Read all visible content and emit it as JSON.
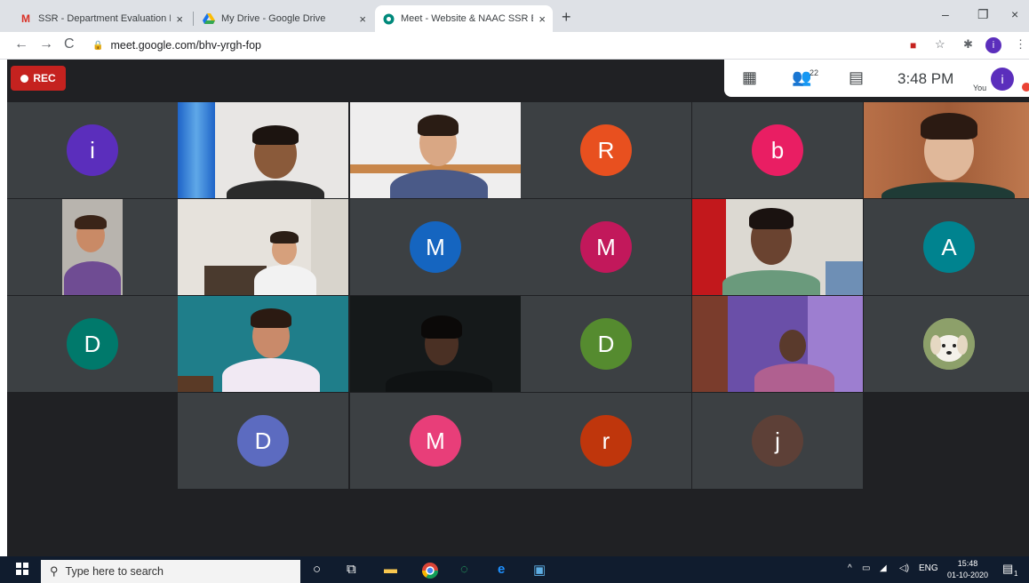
{
  "browser": {
    "tabs": [
      {
        "label": "SSR - Department Evaluation Rep",
        "close": "×",
        "icon": "gmail-icon"
      },
      {
        "label": "My Drive - Google Drive",
        "close": "×",
        "icon": "drive-icon"
      },
      {
        "label": "Meet - Website & NAAC SSR Eva",
        "close": "×",
        "icon": "meet-icon"
      }
    ],
    "new_tab": "+",
    "url": "meet.google.com/bhv-yrgh-fop",
    "profile_initial": "i",
    "window_controls": {
      "minimize": "–",
      "restore": "❐",
      "close": "×"
    }
  },
  "meet": {
    "rec_label": "REC",
    "participants_count": "22",
    "time": "3:48 PM",
    "you_label": "You",
    "you_initial": "i",
    "tiles": [
      {
        "type": "avatar",
        "initial": "i",
        "color": "#5b2ebc"
      },
      {
        "type": "video",
        "variant": "blue-curtain"
      },
      {
        "type": "video",
        "variant": "white-wall"
      },
      {
        "type": "empty"
      },
      {
        "type": "avatar",
        "initial": "R",
        "color": "#e8501f"
      },
      {
        "type": "avatar",
        "initial": "b",
        "color": "#e91e63"
      },
      {
        "type": "video",
        "variant": "wood-headset"
      },
      {
        "type": "video",
        "variant": "small-portrait"
      },
      {
        "type": "video",
        "variant": "room-white"
      },
      {
        "type": "avatar",
        "initial": "M",
        "color": "#1565c0"
      },
      {
        "type": "avatar",
        "initial": "M",
        "color": "#c2185b"
      },
      {
        "type": "video",
        "variant": "red-curtain"
      },
      {
        "type": "avatar",
        "initial": "A",
        "color": "#00838f"
      },
      {
        "type": "avatar",
        "initial": "D",
        "color": "#00796b"
      },
      {
        "type": "video",
        "variant": "teal-wall"
      },
      {
        "type": "video",
        "variant": "dark-room"
      },
      {
        "type": "avatar",
        "initial": "D",
        "color": "#558b2f"
      },
      {
        "type": "video",
        "variant": "purple-room"
      },
      {
        "type": "avatar",
        "initial": "",
        "color": "#8d9b6a",
        "dog": true
      },
      {
        "type": "avatar",
        "initial": "D",
        "color": "#5c6bc0"
      },
      {
        "type": "avatar",
        "initial": "M",
        "color": "#e83e79"
      },
      {
        "type": "avatar",
        "initial": "r",
        "color": "#bf360c"
      },
      {
        "type": "avatar",
        "initial": "j",
        "color": "#5d4037"
      }
    ]
  },
  "taskbar": {
    "search_placeholder": "Type here to search",
    "language": "ENG",
    "clock_time": "15:48",
    "clock_date": "01-10-2020",
    "notification_count": "1"
  }
}
